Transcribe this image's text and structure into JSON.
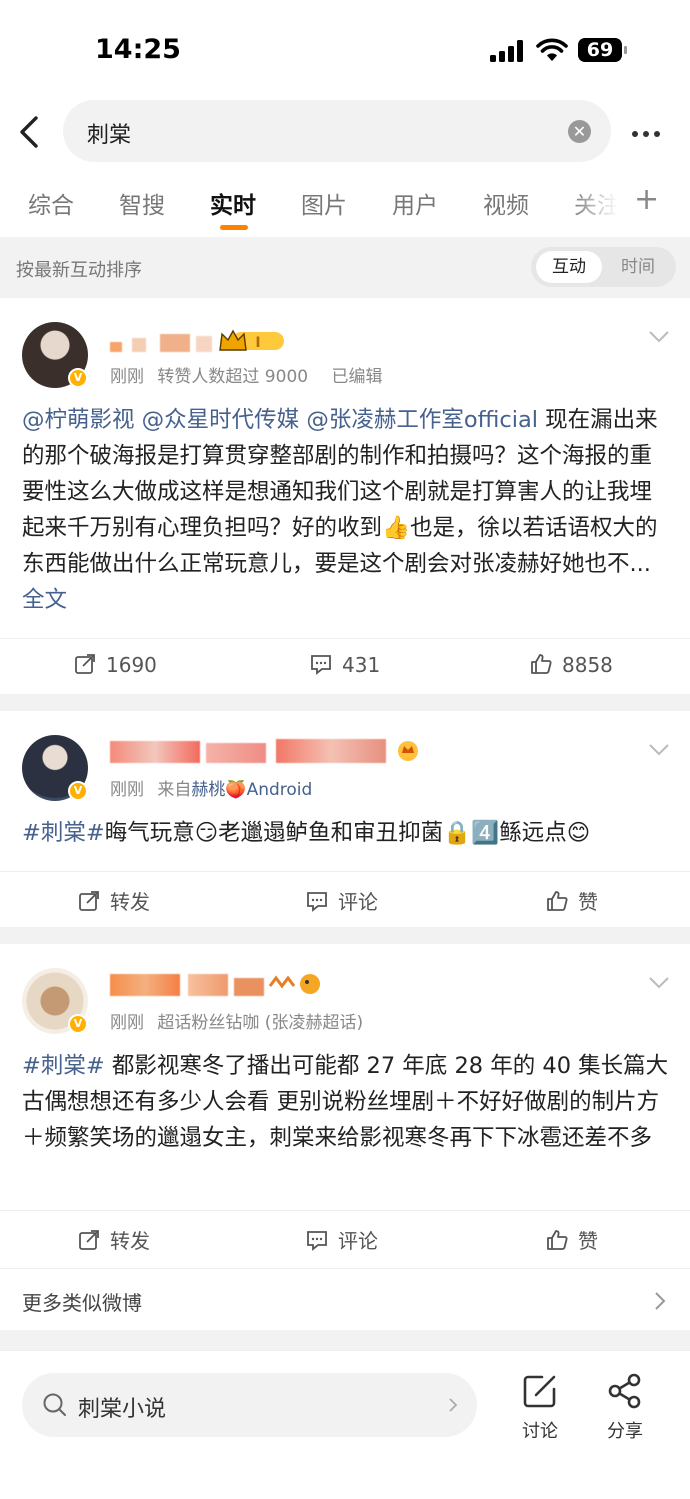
{
  "status_bar": {
    "time": "14:25",
    "battery": "69"
  },
  "search": {
    "query": "刺棠"
  },
  "tabs": [
    {
      "label": "综合"
    },
    {
      "label": "智搜"
    },
    {
      "label": "实时"
    },
    {
      "label": "图片"
    },
    {
      "label": "用户"
    },
    {
      "label": "视频"
    },
    {
      "label": "关注"
    }
  ],
  "active_tab": "实时",
  "sort": {
    "label": "按最新互动排序",
    "option_on": "互动",
    "option_off": "时间"
  },
  "posts": [
    {
      "meta_time": "刚刚",
      "meta_extra": "转赞人数超过 9000",
      "meta_edited": "已编辑",
      "mentions": [
        "@柠萌影视",
        "@众星时代传媒",
        "@张凌赫工作室official"
      ],
      "text": " 现在漏出来的那个破海报是打算贯穿整部剧的制作和拍摄吗？这个海报的重要性这么大做成这样是想通知我们这个剧就是打算害人的让我埋起来千万别有心理负担吗？好的收到👍也是，徐以若话语权大的东西能做出什么正常玩意儿，要是这个剧会对张凌赫好她也不...",
      "fulltext": "全文",
      "repost": "1690",
      "comment": "431",
      "like": "8858"
    },
    {
      "meta_time": "刚刚",
      "meta_from": "来自",
      "meta_source": "赫桃🍑",
      "meta_device": "Android",
      "hashtag": "#刺棠#",
      "text": "晦气玩意😏老邋遢鲈鱼和审丑抑菌🔒4️⃣鲧远点😊",
      "repost": "转发",
      "comment": "评论",
      "like": "赞"
    },
    {
      "meta_time": "刚刚",
      "meta_extra": "超话粉丝钻咖 (张凌赫超话)",
      "hashtag": "#刺棠#",
      "text": " 都影视寒冬了播出可能都 27 年底 28 年的 40 集长篇大古偶想想还有多少人会看 更别说粉丝埋剧＋不好好做剧的制片方＋频繁笑场的邋遢女主，刺棠来给影视寒冬再下下冰雹还差不多",
      "repost": "转发",
      "comment": "评论",
      "like": "赞"
    }
  ],
  "more_similar": "更多类似微博",
  "bottom": {
    "search_text": "刺棠小说",
    "discuss": "讨论",
    "share": "分享"
  },
  "colors": {
    "accent": "#ff8200",
    "link": "#46618e",
    "vip_badge": "#ffb000"
  }
}
